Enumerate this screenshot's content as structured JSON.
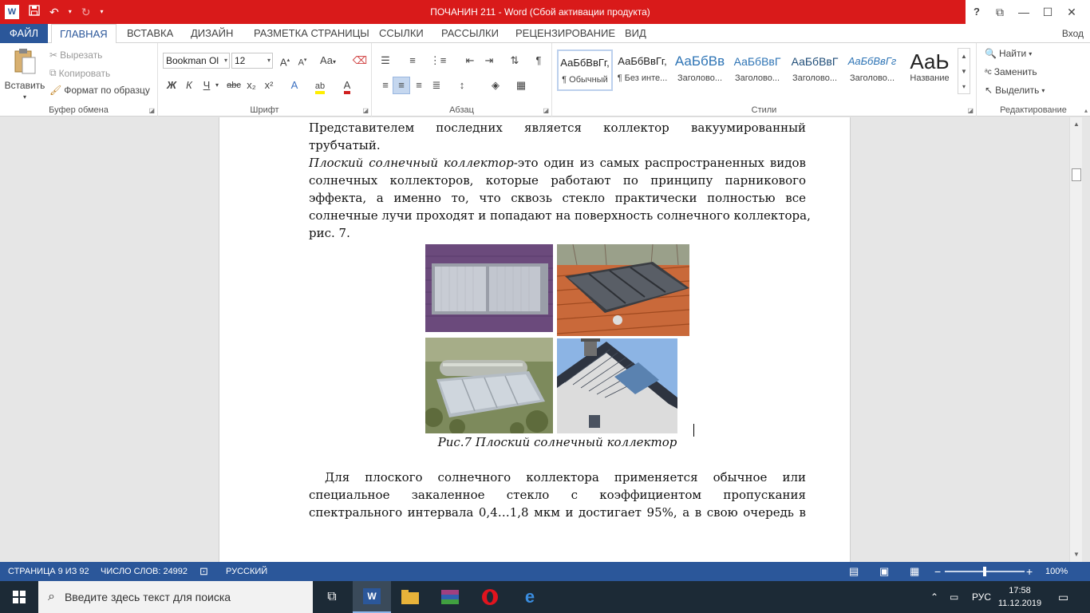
{
  "window": {
    "title": "ПОЧАНИН 211 -  Word (Сбой активации продукта)",
    "help": "?",
    "qat_icons": [
      "word-logo-icon",
      "save-icon",
      "undo-icon",
      "redo-icon",
      "customize-qat-icon"
    ]
  },
  "tabs": [
    {
      "label": "ФАЙЛ"
    },
    {
      "label": "ГЛАВНАЯ"
    },
    {
      "label": "ВСТАВКА"
    },
    {
      "label": "ДИЗАЙН"
    },
    {
      "label": "РАЗМЕТКА СТРАНИЦЫ"
    },
    {
      "label": "ССЫЛКИ"
    },
    {
      "label": "РАССЫЛКИ"
    },
    {
      "label": "РЕЦЕНЗИРОВАНИЕ"
    },
    {
      "label": "ВИД"
    }
  ],
  "login_label": "Вход",
  "clipboard": {
    "paste": "Вставить",
    "cut": "Вырезать",
    "copy": "Копировать",
    "format_painter": "Формат по образцу",
    "group_label": "Буфер обмена"
  },
  "font": {
    "family": "Bookman Ol",
    "size": "12",
    "group_label": "Шрифт",
    "change_case": "Aa",
    "bold": "Ж",
    "italic": "К",
    "underline": "Ч",
    "strike": "abc",
    "subscript": "x₂",
    "superscript": "x²",
    "grow": "A",
    "shrink": "A",
    "effects": "A",
    "color": "A"
  },
  "paragraph": {
    "group_label": "Абзац",
    "pilcrow": "¶"
  },
  "styles": {
    "group_label": "Стили",
    "items": [
      {
        "sample": "АаБбВвГг,",
        "name": "¶ Обычный"
      },
      {
        "sample": "АаБбВвГг,",
        "name": "¶ Без инте..."
      },
      {
        "sample": "АаБбВв",
        "name": "Заголово..."
      },
      {
        "sample": "АаБбВвГ",
        "name": "Заголово..."
      },
      {
        "sample": "АаБбВвГ",
        "name": "Заголово..."
      },
      {
        "sample": "АаБбВвГг",
        "name": "Заголово..."
      },
      {
        "sample": "АаЬ",
        "name": "Название"
      }
    ]
  },
  "editing": {
    "find": "Найти",
    "replace": "Заменить",
    "select": "Выделить",
    "group_label": "Редактирование"
  },
  "document": {
    "p1_lines": [
      "Представителем последних является коллектор вакуумированный",
      "трубчатый."
    ],
    "p2_italic": "Плоский солнечный коллектор",
    "p2_line1_rest": "-это один из самых распространенных видов",
    "p2_lines": [
      "солнечных коллекторов, которые работают по принципу парникового",
      "эффекта, а именно то, что сквозь стекло практически полностью все",
      "солнечные лучи проходят и попадают на поверхность солнечного коллектора,",
      "рис. 7."
    ],
    "caption": "Рис.7 Плоский солнечный коллектор",
    "p3_lines": [
      "Для плоского солнечного коллектора применяется обычное или",
      "специальное закаленное стекло с коэффициентом пропускания",
      "спектрального интервала 0,4…1,8 мкм и достигает 95%, а в свою очередь в"
    ]
  },
  "statusbar": {
    "page": "СТРАНИЦА 9 ИЗ 92",
    "words": "ЧИСЛО СЛОВ: 24992",
    "language": "РУССКИЙ",
    "zoom": "100%",
    "zoom_fraction": 0.5
  },
  "taskbar": {
    "search_placeholder": "Введите здесь текст для поиска",
    "lang": "РУС",
    "time": "17:58",
    "date": "11.12.2019"
  },
  "colors": {
    "word_blue": "#2b579a",
    "title_red": "#d91a1a",
    "taskbar": "#1c2a36"
  }
}
